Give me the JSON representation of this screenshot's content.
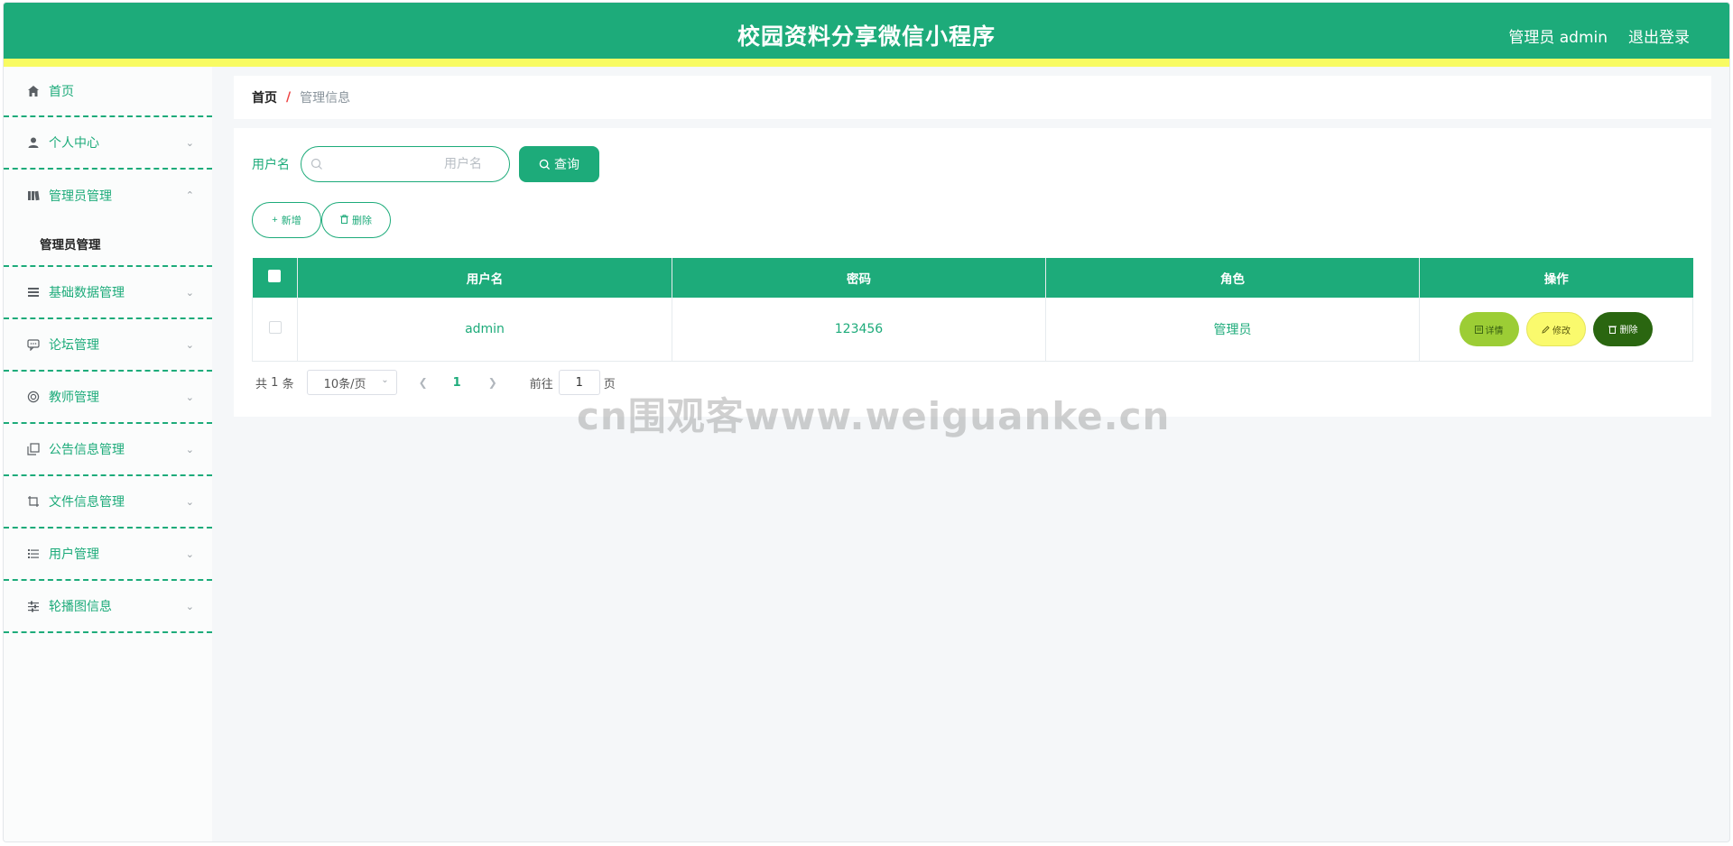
{
  "header": {
    "title": "校园资料分享微信小程序",
    "user": "管理员 admin",
    "logout": "退出登录"
  },
  "sidebar": {
    "items": [
      {
        "label": "首页",
        "icon": "home-icon"
      },
      {
        "label": "个人中心",
        "icon": "user-icon"
      },
      {
        "label": "管理员管理",
        "icon": "notebook-icon",
        "expanded": true,
        "children": [
          {
            "label": "管理员管理"
          }
        ]
      },
      {
        "label": "基础数据管理",
        "icon": "list-icon"
      },
      {
        "label": "论坛管理",
        "icon": "chat-icon"
      },
      {
        "label": "教师管理",
        "icon": "lifebuoy-icon"
      },
      {
        "label": "公告信息管理",
        "icon": "copy-icon"
      },
      {
        "label": "文件信息管理",
        "icon": "crop-icon"
      },
      {
        "label": "用户管理",
        "icon": "menu-lines-icon"
      },
      {
        "label": "轮播图信息",
        "icon": "sliders-icon"
      }
    ]
  },
  "breadcrumb": {
    "home": "首页",
    "separator": "/",
    "current": "管理信息"
  },
  "search": {
    "label": "用户名",
    "placeholder": "用户名",
    "value": "",
    "button": "查询"
  },
  "actions": {
    "add": "新增",
    "delete": "删除"
  },
  "table": {
    "columns": [
      "用户名",
      "密码",
      "角色",
      "操作"
    ],
    "rows": [
      {
        "username": "admin",
        "password": "123456",
        "role": "管理员",
        "ops": {
          "detail": "详情",
          "edit": "修改",
          "delete": "删除"
        }
      }
    ]
  },
  "pagination": {
    "total_prefix": "共",
    "total": "1",
    "total_suffix": "条",
    "page_size": "10条/页",
    "current_page": "1",
    "goto_prefix": "前往",
    "goto_value": "1",
    "goto_suffix": "页"
  },
  "watermark": "cn围观客www.weiguanke.cn",
  "colors": {
    "primary": "#1dab7a",
    "accent_yellow": "#f8fb62",
    "detail_btn": "#9ccd35",
    "edit_btn": "#fafa6d",
    "delete_btn": "#2a6610"
  }
}
